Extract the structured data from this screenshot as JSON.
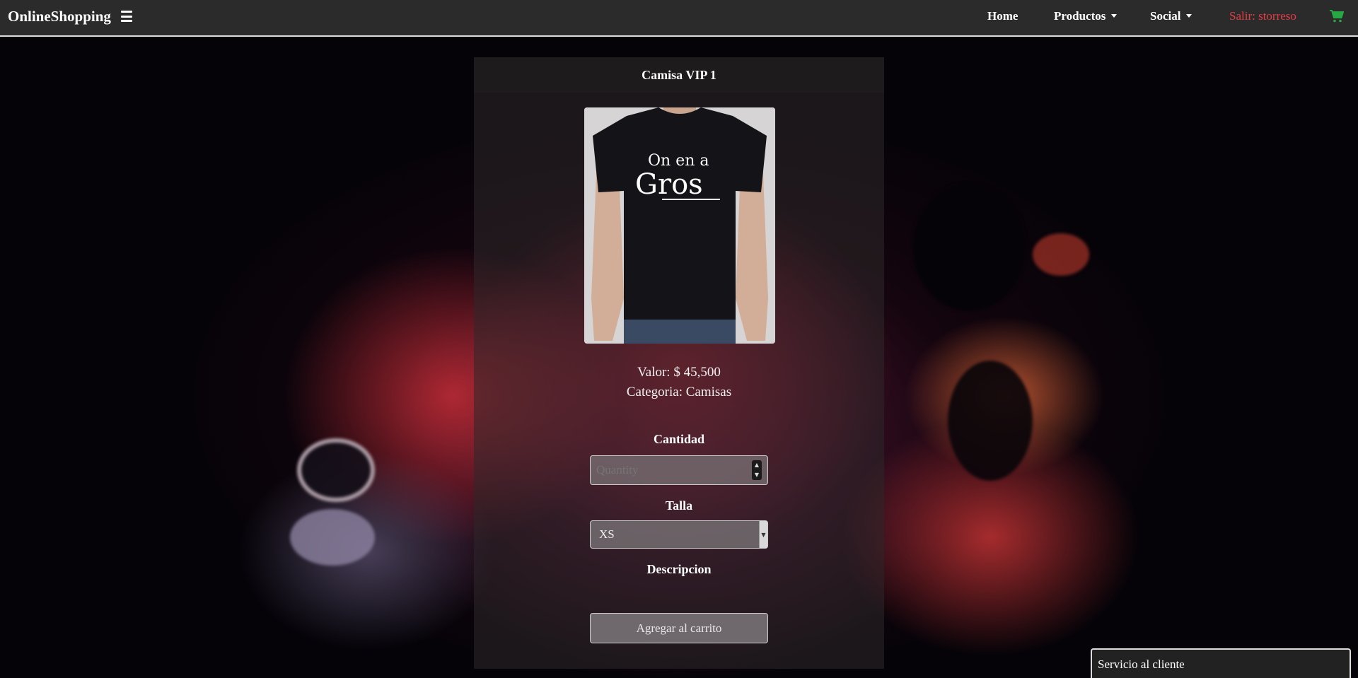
{
  "navbar": {
    "brand": "OnlineShopping",
    "home": "Home",
    "productos": "Productos",
    "social": "Social",
    "logout": "Salir: storreso"
  },
  "product": {
    "title": "Camisa VIP 1",
    "image_text_line1": "On en a",
    "image_text_line2": "Gros",
    "valor": "Valor: $ 45,500",
    "categoria": "Categoria: Camisas"
  },
  "form": {
    "cantidad_label": "Cantidad",
    "quantity_placeholder": "Quantity",
    "talla_label": "Talla",
    "talla_selected": "XS",
    "descripcion_label": "Descripcion",
    "add_button": "Agregar al carrito"
  },
  "chat": {
    "label": "Servicio al cliente"
  },
  "colors": {
    "logout": "#e33d45",
    "cart": "#28a745",
    "navbar": "#2b2b2b"
  }
}
